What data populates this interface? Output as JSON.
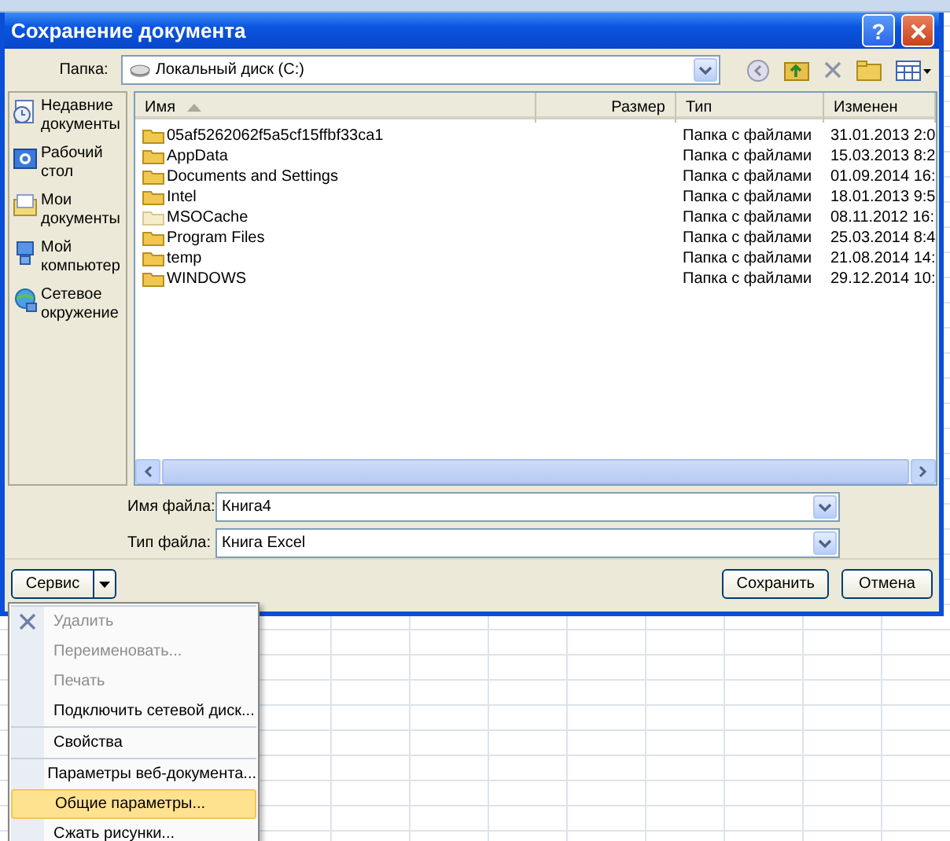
{
  "window": {
    "title": "Сохранение документа",
    "buttons": [
      "?"
    ]
  },
  "folder": {
    "label": "Папка:",
    "value": "Локальный диск (C:)"
  },
  "sidebar": {
    "items": [
      {
        "label": "Недавние документы"
      },
      {
        "label": "Рабочий стол"
      },
      {
        "label": "Мои документы"
      },
      {
        "label": "Мой компьютер"
      },
      {
        "label": "Сетевое окружение"
      }
    ]
  },
  "table": {
    "columns": [
      {
        "label": "Имя",
        "sorted": true
      },
      {
        "label": "Размер",
        "sorted": false
      },
      {
        "label": "Тип",
        "sorted": false
      },
      {
        "label": "Изменен",
        "sorted": false
      }
    ],
    "rows": [
      {
        "name": "05af5262062f5a5cf15ffbf33ca1",
        "type": "Папка с файлами",
        "modified": "31.01.2013 2:0",
        "hidden": false
      },
      {
        "name": "AppData",
        "type": "Папка с файлами",
        "modified": "15.03.2013 8:2",
        "hidden": false
      },
      {
        "name": "Documents and Settings",
        "type": "Папка с файлами",
        "modified": "01.09.2014 16:",
        "hidden": false
      },
      {
        "name": "Intel",
        "type": "Папка с файлами",
        "modified": "18.01.2013 9:5",
        "hidden": false
      },
      {
        "name": "MSOCache",
        "type": "Папка с файлами",
        "modified": "08.11.2012 16:",
        "hidden": true
      },
      {
        "name": "Program Files",
        "type": "Папка с файлами",
        "modified": "25.03.2014 8:4",
        "hidden": false
      },
      {
        "name": "temp",
        "type": "Папка с файлами",
        "modified": "21.08.2014 14:",
        "hidden": false
      },
      {
        "name": "WINDOWS",
        "type": "Папка с файлами",
        "modified": "29.12.2014 10:",
        "hidden": false
      }
    ]
  },
  "fields": [
    {
      "label": "Имя файла:",
      "value": "Книга4"
    },
    {
      "label": "Тип файла:",
      "value": "Книга Excel"
    }
  ],
  "tools_button": "Сервис",
  "buttons": [
    "Сохранить",
    "Отмена"
  ],
  "menu": {
    "groups": [
      [
        {
          "label": "Удалить",
          "disabled": true,
          "selected": false,
          "has_icon": true
        },
        {
          "label": "Переименовать...",
          "disabled": true,
          "selected": false
        },
        {
          "label": "Печать",
          "disabled": true,
          "selected": false
        },
        {
          "label": "Подключить сетевой диск...",
          "disabled": false,
          "selected": false
        }
      ],
      [
        {
          "label": "Свойства",
          "disabled": false,
          "selected": false
        }
      ],
      [
        {
          "label": "Параметры веб-документа...",
          "disabled": false,
          "selected": false
        },
        {
          "label": "Общие параметры...",
          "disabled": false,
          "selected": true
        },
        {
          "label": "Сжать рисунки...",
          "disabled": false,
          "selected": false
        }
      ]
    ]
  }
}
